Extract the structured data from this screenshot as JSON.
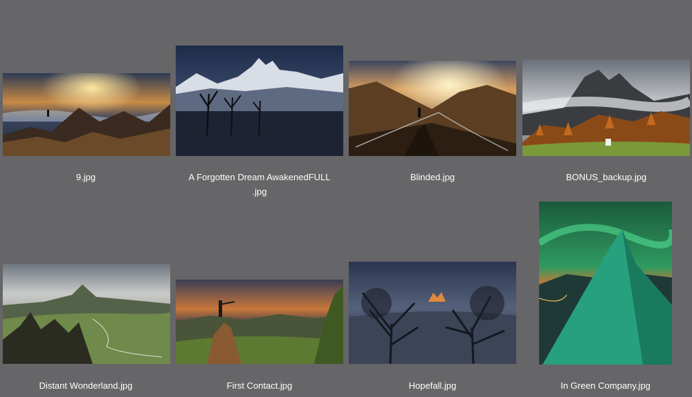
{
  "files": [
    {
      "name": "9.jpg",
      "icon": "image-thumbnail"
    },
    {
      "name": "A Forgotten Dream AwakenedFULL\n.jpg",
      "icon": "image-thumbnail"
    },
    {
      "name": "Blinded.jpg",
      "icon": "image-thumbnail"
    },
    {
      "name": "BONUS_backup.jpg",
      "icon": "image-thumbnail"
    },
    {
      "name": "Distant Wonderland.jpg",
      "icon": "image-thumbnail"
    },
    {
      "name": "First Contact.jpg",
      "icon": "image-thumbnail"
    },
    {
      "name": "Hopefall.jpg",
      "icon": "image-thumbnail"
    },
    {
      "name": "In Green Company.jpg",
      "icon": "image-thumbnail"
    }
  ],
  "colors": {
    "background": "#666567",
    "label_text": "#ffffff"
  }
}
